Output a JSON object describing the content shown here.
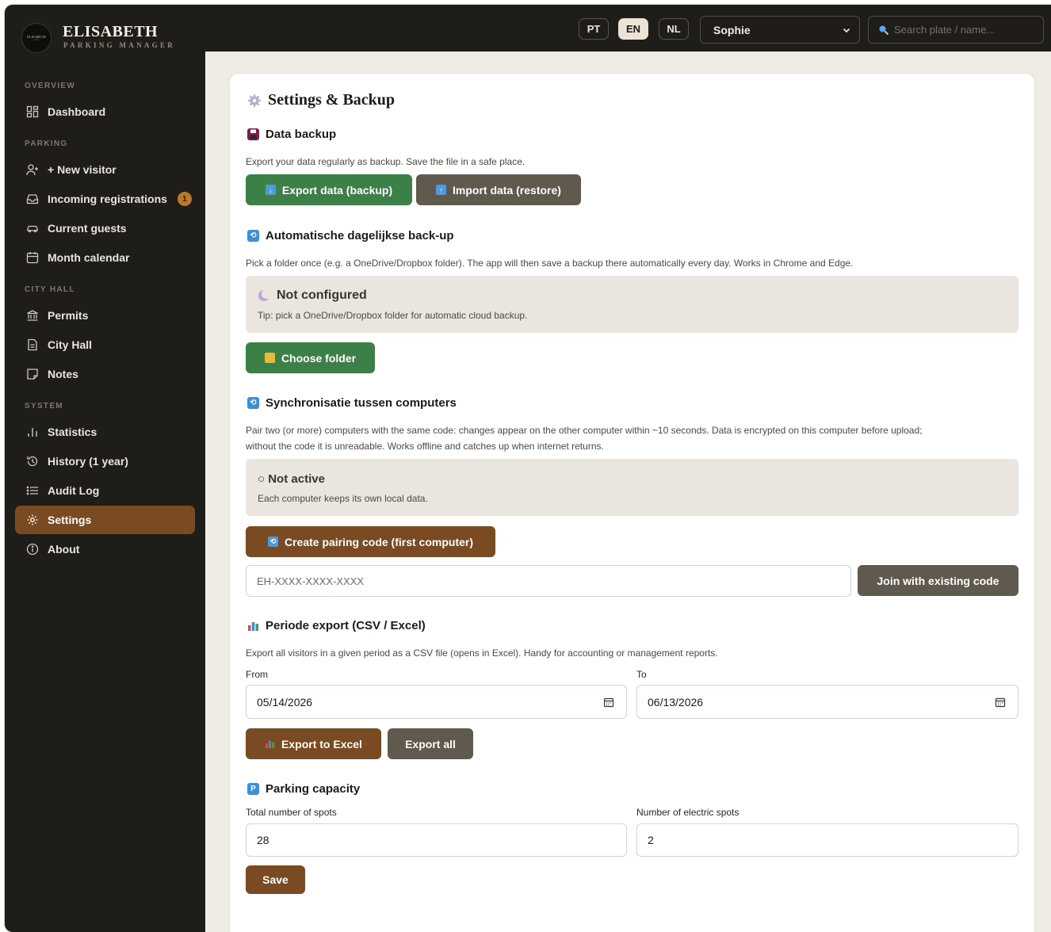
{
  "brand": {
    "logo_text": "ELISABETH",
    "logo_sub": "HOTEL",
    "name": "ELISABETH",
    "subtitle": "PARKING MANAGER"
  },
  "nav": {
    "sections": {
      "overview": "OVERVIEW",
      "parking": "PARKING",
      "city_hall": "CITY HALL",
      "system": "SYSTEM"
    },
    "items": [
      {
        "label": "Dashboard",
        "icon": "grid-icon"
      },
      {
        "label": "+ New visitor",
        "icon": "add-user-icon"
      },
      {
        "label": "Incoming registrations",
        "icon": "inbox-icon",
        "badge": "1"
      },
      {
        "label": "Current guests",
        "icon": "car-icon"
      },
      {
        "label": "Month calendar",
        "icon": "calendar-icon"
      },
      {
        "label": "Permits",
        "icon": "bank-icon"
      },
      {
        "label": "City Hall",
        "icon": "document-icon"
      },
      {
        "label": "Notes",
        "icon": "note-icon"
      },
      {
        "label": "Statistics",
        "icon": "bar-chart-icon"
      },
      {
        "label": "History (1 year)",
        "icon": "history-icon"
      },
      {
        "label": "Audit Log",
        "icon": "list-icon"
      },
      {
        "label": "Settings",
        "icon": "gear-icon",
        "active": true
      },
      {
        "label": "About",
        "icon": "info-icon"
      }
    ]
  },
  "topbar": {
    "languages": [
      "PT",
      "EN",
      "NL"
    ],
    "active_language": "EN",
    "user": "Sophie",
    "search_placeholder": "Search plate / name..."
  },
  "page": {
    "title": "Settings & Backup",
    "backup": {
      "title": "Data backup",
      "desc": "Export your data regularly as backup. Save the file in a safe place.",
      "export_btn": "Export data (backup)",
      "import_btn": "Import data (restore)"
    },
    "auto_backup": {
      "title": "Automatische dagelijkse back-up",
      "desc": "Pick a folder once (e.g. a OneDrive/Dropbox folder). The app will then save a backup there automatically every day. Works in Chrome and Edge.",
      "status": "Not configured",
      "tip": "Tip: pick a OneDrive/Dropbox folder for automatic cloud backup.",
      "choose_btn": "Choose folder"
    },
    "sync": {
      "title": "Synchronisatie tussen computers",
      "desc1": "Pair two (or more) computers with the same code: changes appear on the other computer within ~10 seconds. Data is encrypted on this computer before upload;",
      "desc2": "without the code it is unreadable. Works offline and catches up when internet returns.",
      "status": "○ Not active",
      "status_desc": "Each computer keeps its own local data.",
      "create_btn": "Create pairing code (first computer)",
      "code_placeholder": "EH-XXXX-XXXX-XXXX",
      "join_btn": "Join with existing code"
    },
    "period_export": {
      "title": "Periode export (CSV / Excel)",
      "desc": "Export all visitors in a given period as a CSV file (opens in Excel). Handy for accounting or management reports.",
      "from_label": "From",
      "from_value": "05/14/2026",
      "to_label": "To",
      "to_value": "06/13/2026",
      "excel_btn": "Export to Excel",
      "all_btn": "Export all"
    },
    "capacity": {
      "title": "Parking capacity",
      "total_label": "Total number of spots",
      "total_value": "28",
      "electric_label": "Number of electric spots",
      "electric_value": "2",
      "save_btn": "Save"
    }
  },
  "colors": {
    "sidebar_bg": "#1e1d19",
    "accent_brown": "#7a4a22",
    "green": "#3c7f47",
    "gray_btn": "#5f594e",
    "panel_bg": "#ebe5e0"
  }
}
